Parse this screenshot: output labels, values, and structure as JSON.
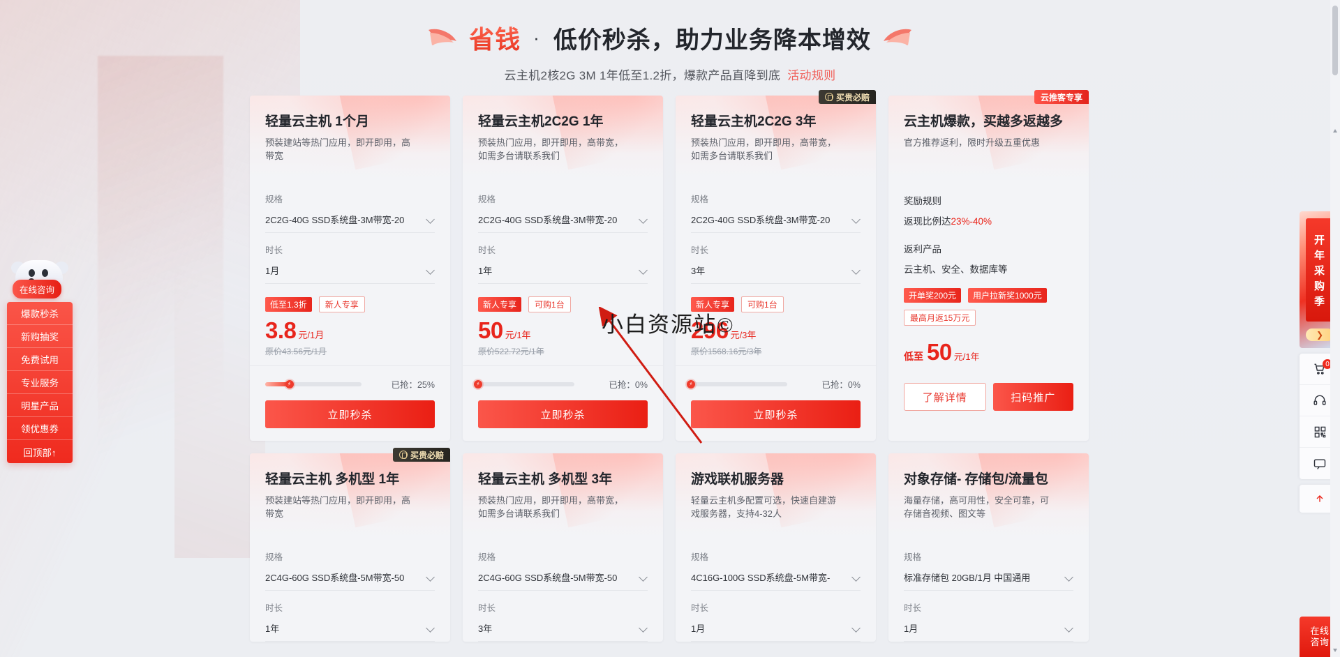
{
  "header": {
    "title_word": "省钱",
    "separator": "·",
    "title_main": "低价秒杀，助力业务降本增效",
    "subtitle": "云主机2核2G 3M 1年低至1.2折，爆款产品直降到底",
    "rule_link": "活动规则"
  },
  "labels": {
    "spec": "规格",
    "duration": "时长",
    "grabbed_prefix": "已抢：",
    "buy_now": "立即秒杀",
    "learn_more": "了解详情",
    "qr_promote": "扫码推广",
    "guarantee_badge": "买贵必赔",
    "promoter_badge": "云推客专享",
    "reward_rule_label": "奖励规则",
    "rebate_product_label": "返利产品",
    "price_prefix_low": "低至"
  },
  "cards": [
    {
      "title": "轻量云主机 1个月",
      "desc": "预装建站等热门应用，即开即用，高带宽",
      "badge": null,
      "spec": "2C2G-40G SSD系统盘-3M带宽-20",
      "duration": "1月",
      "tags": [
        {
          "text": "低至1.3折",
          "style": "solid"
        },
        {
          "text": "新人专享",
          "style": "outline"
        }
      ],
      "price": "3.8",
      "price_unit": "元/1月",
      "price_origin": "原价43.56元/1月",
      "progress": 25,
      "progress_text": "已抢：25%",
      "buttons": [
        {
          "label": "立即秒杀",
          "style": "primary"
        }
      ]
    },
    {
      "title": "轻量云主机2C2G 1年",
      "desc": "预装热门应用，即开即用，高带宽，如需多台请联系我们",
      "badge": null,
      "spec": "2C2G-40G SSD系统盘-3M带宽-20",
      "duration": "1年",
      "tags": [
        {
          "text": "新人专享",
          "style": "solid"
        },
        {
          "text": "可购1台",
          "style": "outline"
        }
      ],
      "price": "50",
      "price_unit": "元/1年",
      "price_origin": "原价522.72元/1年",
      "progress": 0,
      "progress_text": "已抢：0%",
      "buttons": [
        {
          "label": "立即秒杀",
          "style": "primary"
        }
      ]
    },
    {
      "title": "轻量云主机2C2G 3年",
      "desc": "预装热门应用，即开即用，高带宽，如需多台请联系我们",
      "badge": "买贵必赔",
      "badge_style": "dark",
      "spec": "2C2G-40G SSD系统盘-3M带宽-20",
      "duration": "3年",
      "tags": [
        {
          "text": "新人专享",
          "style": "solid"
        },
        {
          "text": "可购1台",
          "style": "outline"
        }
      ],
      "price": "296",
      "price_unit": "元/3年",
      "price_origin": "原价1568.16元/3年",
      "progress": 0,
      "progress_text": "已抢：0%",
      "buttons": [
        {
          "label": "立即秒杀",
          "style": "primary"
        }
      ]
    },
    {
      "title": "云主机爆款，买越多返越多",
      "desc": "官方推荐返利，限时升级五重优惠",
      "badge": "云推客专享",
      "badge_style": "promo",
      "reward_rule_label": "奖励规则",
      "reward_rule_text_plain": "返现比例达",
      "reward_rule_text_accent": "23%-40%",
      "rebate_product_label": "返利产品",
      "rebate_product_text": "云主机、安全、数据库等",
      "tags": [
        {
          "text": "开单奖200元",
          "style": "solid"
        },
        {
          "text": "用户拉新奖1000元",
          "style": "solid"
        },
        {
          "text": "最高月返15万元",
          "style": "outline"
        }
      ],
      "price_prefix": "低至",
      "price": "50",
      "price_unit": "元/1年",
      "buttons": [
        {
          "label": "了解详情",
          "style": "ghost"
        },
        {
          "label": "扫码推广",
          "style": "primary"
        }
      ]
    },
    {
      "title": "轻量云主机 多机型 1年",
      "desc": "预装建站等热门应用，即开即用，高带宽",
      "badge": "买贵必赔",
      "badge_style": "dark",
      "spec": "2C4G-60G SSD系统盘-5M带宽-50",
      "duration": "1年"
    },
    {
      "title": "轻量云主机 多机型 3年",
      "desc": "预装热门应用，即开即用，高带宽，如需多台请联系我们",
      "badge": null,
      "spec": "2C4G-60G SSD系统盘-5M带宽-50",
      "duration": "3年"
    },
    {
      "title": "游戏联机服务器",
      "desc": "轻量云主机多配置可选，快速自建游戏服务器，支持4-32人",
      "badge": null,
      "spec": "4C16G-100G SSD系统盘-5M带宽-",
      "duration": "1月"
    },
    {
      "title": "对象存储- 存储包/流量包",
      "desc": "海量存储，高可用性，安全可靠，可存储音视频、图文等",
      "badge": null,
      "spec": "标准存储包 20GB/1月 中国通用",
      "duration": "1月"
    }
  ],
  "left_nav": {
    "chat_pill": "在线咨询",
    "items": [
      {
        "label": "爆款秒杀"
      },
      {
        "label": "新购抽奖"
      },
      {
        "label": "免费试用"
      },
      {
        "label": "专业服务"
      },
      {
        "label": "明星产品"
      },
      {
        "label": "领优惠券"
      },
      {
        "label": "回顶部↑"
      }
    ]
  },
  "right_rail": {
    "banner_text": "开年采购季",
    "banner_arrow": "❯",
    "cart_badge": "0",
    "consult_line1": "在线",
    "consult_line2": "咨询"
  },
  "watermark": "小白资源站©",
  "colors": {
    "accent_red": "#ea1f14",
    "accent_light": "#fb564a",
    "page_bg": "#eceef2",
    "card_bg": "#f3f4f7",
    "text_dark": "#23262c",
    "text_muted": "#5c6069",
    "badge_dark": "#26241f",
    "badge_gold": "#f3e0b4"
  }
}
